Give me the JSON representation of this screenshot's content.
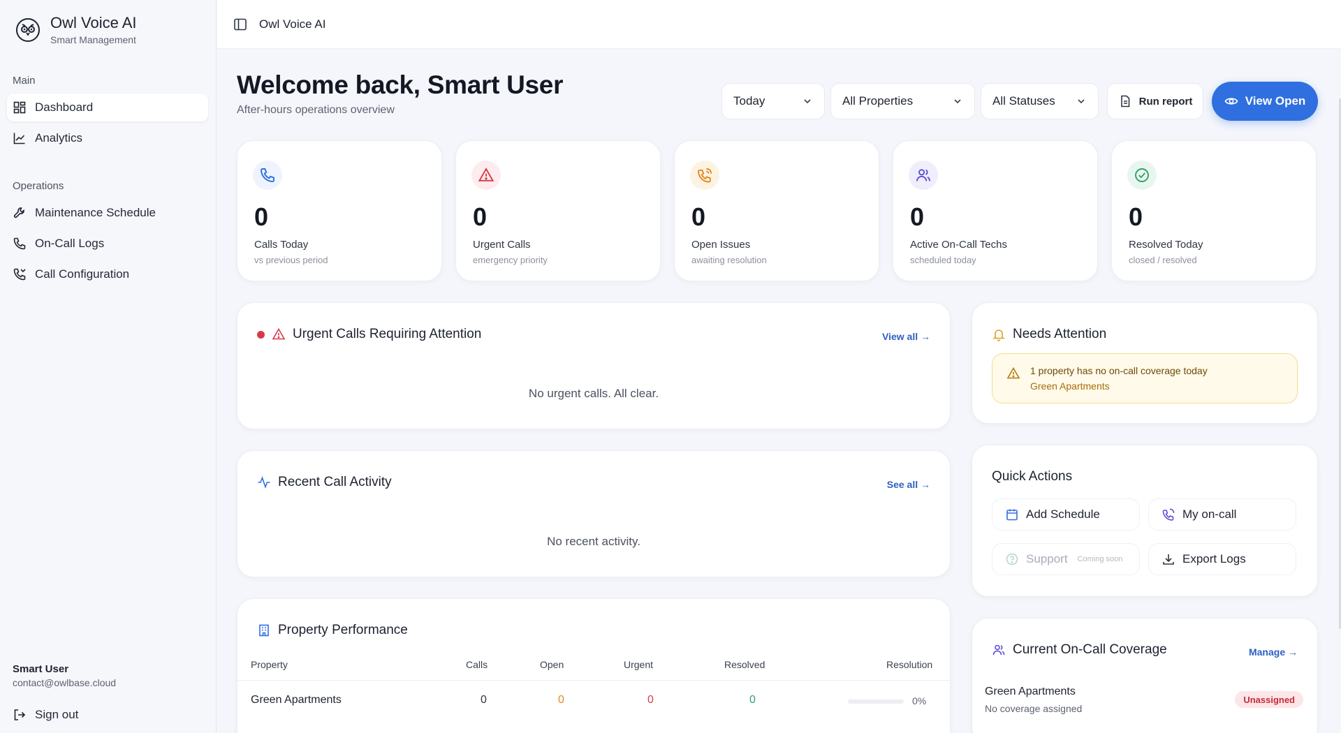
{
  "app": {
    "title": "Owl Voice AI",
    "subtitle": "Smart Management"
  },
  "topbar": {
    "title": "Owl Voice AI"
  },
  "sidebar": {
    "groups": [
      {
        "label": "Main",
        "items": [
          {
            "label": "Dashboard",
            "icon": "grid-icon",
            "active": true
          },
          {
            "label": "Analytics",
            "icon": "line-chart-icon"
          }
        ]
      },
      {
        "label": "Operations",
        "items": [
          {
            "label": "Maintenance Schedule",
            "icon": "wrench-icon"
          },
          {
            "label": "On-Call Logs",
            "icon": "phone-icon"
          },
          {
            "label": "Call Configuration",
            "icon": "phone-settings-icon"
          }
        ]
      }
    ],
    "user": {
      "name": "Smart User",
      "email": "contact@owlbase.cloud"
    },
    "signout_label": "Sign out"
  },
  "header": {
    "welcome": "Welcome back, Smart User",
    "subtitle": "After-hours operations overview",
    "filters": {
      "period": "Today",
      "properties": "All Properties",
      "statuses": "All Statuses"
    },
    "run_report": "Run report",
    "view_open": "View Open"
  },
  "stats": [
    {
      "value": "0",
      "label": "Calls Today",
      "sub": "vs previous period",
      "color": "#2f6fe0"
    },
    {
      "value": "0",
      "label": "Urgent Calls",
      "sub": "emergency priority",
      "color": "#d63a4a"
    },
    {
      "value": "0",
      "label": "Open Issues",
      "sub": "awaiting resolution",
      "color": "#e08a1e"
    },
    {
      "value": "0",
      "label": "Active On-Call Techs",
      "sub": "scheduled today",
      "color": "#5b4fd6"
    },
    {
      "value": "0",
      "label": "Resolved Today",
      "sub": "closed / resolved",
      "color": "#2fa36b"
    }
  ],
  "urgent": {
    "title": "Urgent Calls Requiring Attention",
    "link": "View all →",
    "empty": "No urgent calls. All clear."
  },
  "recent": {
    "title": "Recent Call Activity",
    "link": "See all →",
    "empty": "No recent activity."
  },
  "performance": {
    "title": "Property Performance",
    "columns": [
      "Property",
      "Calls",
      "Open",
      "Urgent",
      "Resolved",
      "Resolution"
    ],
    "rows": [
      {
        "property": "Green Apartments",
        "calls": "0",
        "open": "0",
        "urgent": "0",
        "resolved": "0",
        "resolution": "0%",
        "resolution_fraction": 0
      }
    ]
  },
  "needs_attention": {
    "title": "Needs Attention",
    "alert_title": "1 property has no on-call coverage today",
    "alert_property": "Green Apartments"
  },
  "quick_actions": {
    "title": "Quick Actions",
    "add_schedule": "Add Schedule",
    "my_oncall": "My on-call",
    "support": "Support",
    "support_note": "Coming soon",
    "export_logs": "Export Logs"
  },
  "coverage": {
    "title": "Current On-Call Coverage",
    "link": "Manage →",
    "property": "Green Apartments",
    "note": "No coverage assigned",
    "badge": "Unassigned"
  },
  "colors": {
    "accent": "#2f6fe0",
    "urgent": "#d63a4a",
    "open": "#e08a1e",
    "resolved": "#2fa36b"
  }
}
